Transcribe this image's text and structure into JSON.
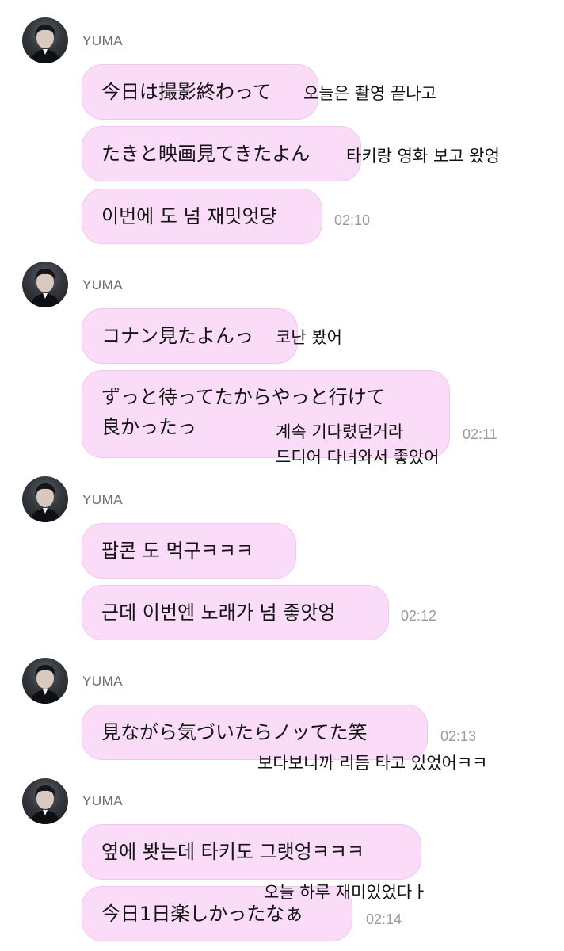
{
  "sender": "YUMA",
  "groups": [
    {
      "messages": [
        {
          "text": "今日は撮影終わって",
          "translation": "오늘은 촬영 끝나고"
        },
        {
          "text": "たきと映画見てきたよん",
          "translation": "타키랑 영화 보고 왔엉"
        },
        {
          "text": "이번에 도 넘 재밋엇댱",
          "time": "02:10"
        }
      ]
    },
    {
      "messages": [
        {
          "text": "コナン見たよんっ",
          "translation": "코난 봤어"
        },
        {
          "text_line1": "ずっと待ってたからやっと行けて",
          "text_line2": "良かったっ",
          "translation_line1": "계속 기다렸던거라",
          "translation_line2": "드디어 다녀와서 좋았어",
          "time": "02:11"
        }
      ]
    },
    {
      "messages": [
        {
          "text": "팝콘 도 먹구ㅋㅋㅋ"
        },
        {
          "text": "근데 이번엔 노래가 넘 좋앗엉",
          "time": "02:12"
        }
      ]
    },
    {
      "messages": [
        {
          "text": "見ながら気づいたらノッてた笑",
          "time": "02:13",
          "translation": "보다보니까 리듬 타고 있었어ㅋㅋ"
        }
      ]
    },
    {
      "messages": [
        {
          "text": "옆에 봣는데 타키도 그랫엉ㅋㅋㅋ"
        },
        {
          "text": "今日1日楽しかったなぁ",
          "time": "02:14",
          "translation": "오늘 하루 재미있었다ㅏ"
        }
      ]
    }
  ]
}
